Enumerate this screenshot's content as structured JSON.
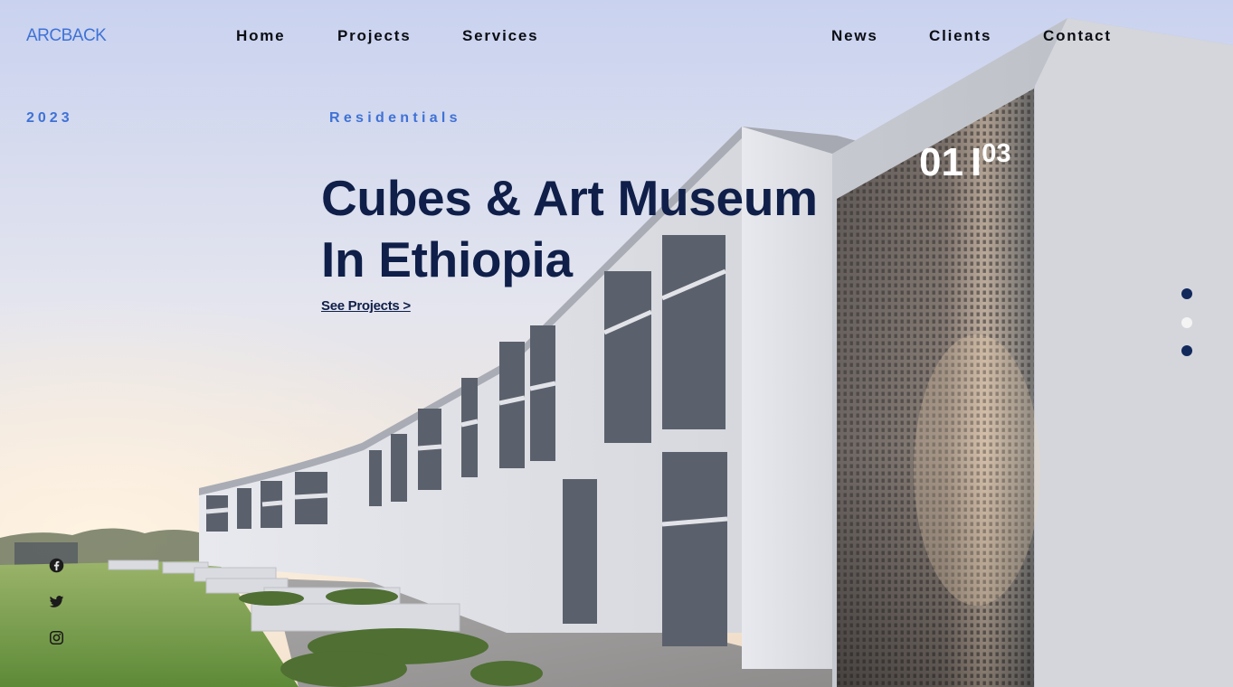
{
  "header": {
    "logo": "ARCBACK",
    "nav": [
      {
        "label": "Home"
      },
      {
        "label": "Projects"
      },
      {
        "label": "Services"
      },
      {
        "label": "News"
      },
      {
        "label": "Clients"
      },
      {
        "label": "Contact"
      }
    ]
  },
  "hero": {
    "year": "2023",
    "category": "Residentials",
    "title_line1": "Cubes & Art Museum",
    "title_line2": "In Ethiopia",
    "cta": "See Projects >",
    "counter": {
      "current": "01",
      "separator": "I",
      "total": "03"
    },
    "slides": {
      "count": 3,
      "active_index": 1
    }
  },
  "social": [
    "facebook-icon",
    "twitter-icon",
    "instagram-icon"
  ],
  "colors": {
    "accent": "#3f72d6",
    "title": "#0f1f49",
    "nav": "#0b0d14",
    "dot": "#12295c",
    "dot_active": "#f4f4f4"
  }
}
